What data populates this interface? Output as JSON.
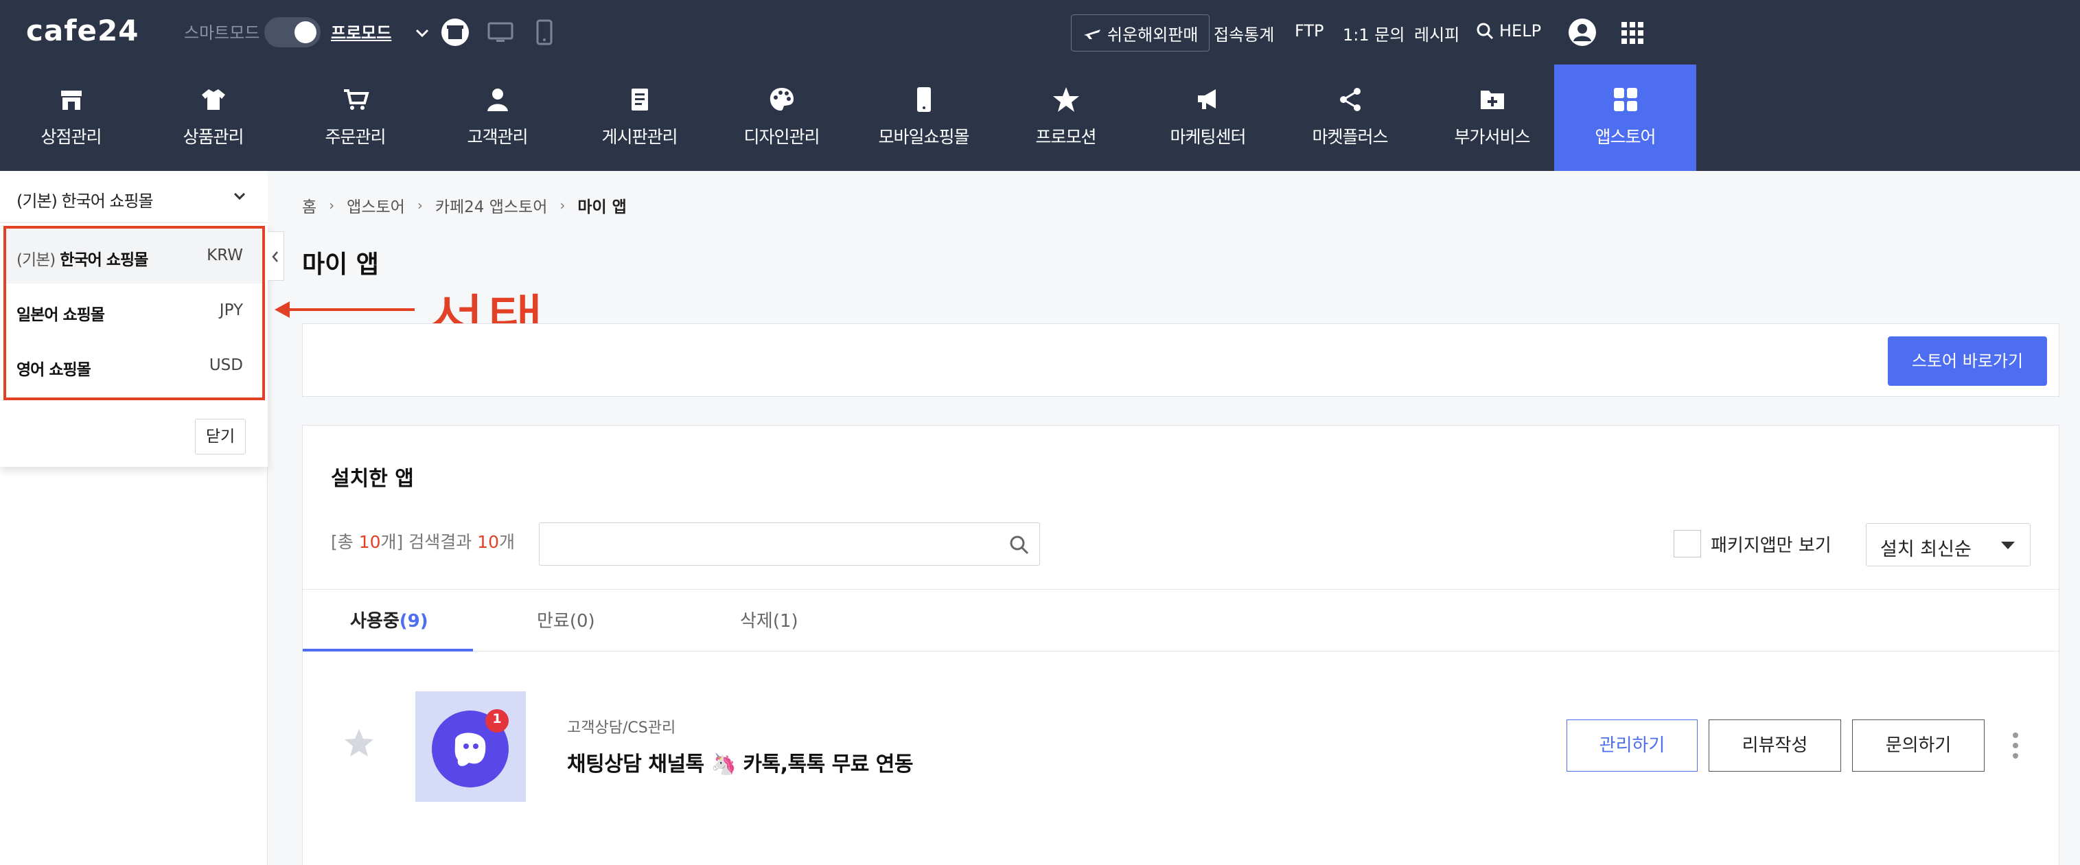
{
  "topbar": {
    "logo": "cafe24",
    "smart_mode": "스마트모드",
    "pro_mode": "프로모드",
    "overseas": "쉬운해외판매",
    "links": [
      "접속통계",
      "FTP",
      "1:1 문의",
      "레시피"
    ],
    "help": "HELP"
  },
  "nav": {
    "items": [
      {
        "label": "상점관리",
        "icon": "store-icon"
      },
      {
        "label": "상품관리",
        "icon": "tshirt-icon"
      },
      {
        "label": "주문관리",
        "icon": "cart-icon"
      },
      {
        "label": "고객관리",
        "icon": "user-icon"
      },
      {
        "label": "게시판관리",
        "icon": "board-icon"
      },
      {
        "label": "디자인관리",
        "icon": "palette-icon"
      },
      {
        "label": "모바일쇼핑몰",
        "icon": "mobile-icon"
      },
      {
        "label": "프로모션",
        "icon": "star-icon"
      },
      {
        "label": "마케팅센터",
        "icon": "megaphone-icon"
      },
      {
        "label": "마켓플러스",
        "icon": "share-icon"
      },
      {
        "label": "부가서비스",
        "icon": "folder-plus-icon"
      },
      {
        "label": "앱스토어",
        "icon": "apps-grid-icon"
      }
    ],
    "active_index": 11
  },
  "shop_selector": {
    "selected_prefix": "(기본)",
    "selected_name": "한국어 쇼핑몰",
    "options": [
      {
        "prefix": "(기본)",
        "name": "한국어 쇼핑몰",
        "currency": "KRW"
      },
      {
        "prefix": "",
        "name": "일본어 쇼핑몰",
        "currency": "JPY"
      },
      {
        "prefix": "",
        "name": "영어 쇼핑몰",
        "currency": "USD"
      }
    ],
    "close_label": "닫기"
  },
  "annotation": {
    "text": "선택",
    "color": "#e34125"
  },
  "breadcrumb": [
    "홈",
    "앱스토어",
    "카페24 앱스토어",
    "마이 앱"
  ],
  "page_title": "마이 앱",
  "store_button": "스토어 바로가기",
  "installed": {
    "title": "설치한 앱",
    "count_prefix": "[총 ",
    "total": "10",
    "count_middle": "개] 검색결과 ",
    "results": "10",
    "count_suffix": "개",
    "search_placeholder": "",
    "package_only_label": "패키지앱만 보기",
    "sort_value": "설치 최신순"
  },
  "tabs": [
    {
      "label": "사용중",
      "count": "(9)"
    },
    {
      "label": "만료",
      "count": "(0)"
    },
    {
      "label": "삭제",
      "count": "(1)"
    }
  ],
  "app": {
    "category": "고객상담/CS관리",
    "name": "채팅상담 채널톡 🦄 카톡,톡톡 무료 연동",
    "badge": "1",
    "buttons": [
      "관리하기",
      "리뷰작성",
      "문의하기"
    ]
  },
  "colors": {
    "nav_bg": "#2c3548",
    "accent": "#4e6ef2",
    "annotation": "#e34125"
  }
}
